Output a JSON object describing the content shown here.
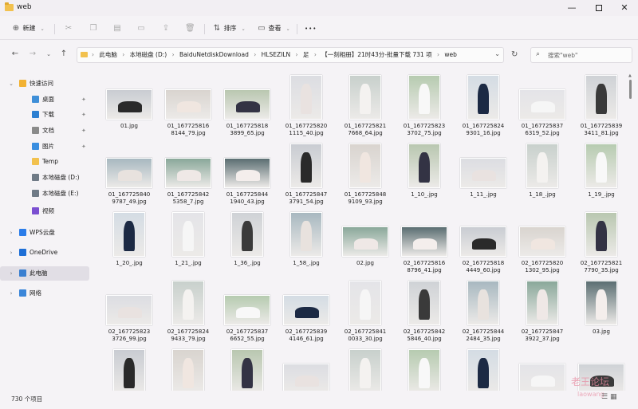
{
  "window": {
    "title": "web"
  },
  "toolbar": {
    "new_label": "新建",
    "sort_label": "排序",
    "view_label": "查看",
    "more_label": "•••"
  },
  "address": {
    "crumbs": [
      "此电脑",
      "本地磁盘 (D:)",
      "BaiduNetdiskDownload",
      "HLSEZILN",
      "足",
      "【一刻相册】21时43分-批量下载 731 项",
      "web"
    ],
    "search_placeholder": "搜索\"web\""
  },
  "sidebar": {
    "items": [
      {
        "label": "快速访问",
        "icon": "star-icon",
        "pinned": false
      },
      {
        "label": "桌面",
        "icon": "desktop-icon",
        "pinned": true
      },
      {
        "label": "下载",
        "icon": "download-icon",
        "pinned": true
      },
      {
        "label": "文档",
        "icon": "document-icon",
        "pinned": true
      },
      {
        "label": "图片",
        "icon": "pictures-icon",
        "pinned": true
      },
      {
        "label": "Temp",
        "icon": "folder-icon",
        "pinned": false
      },
      {
        "label": "本地磁盘 (D:)",
        "icon": "drive-icon",
        "pinned": false
      },
      {
        "label": "本地磁盘 (E:)",
        "icon": "drive-icon",
        "pinned": false
      },
      {
        "label": "视频",
        "icon": "video-icon",
        "pinned": false
      },
      {
        "label": "WPS云盘",
        "icon": "cloud-icon",
        "pinned": false
      },
      {
        "label": "OneDrive",
        "icon": "onedrive-icon",
        "pinned": false
      },
      {
        "label": "此电脑",
        "icon": "computer-icon",
        "pinned": false
      },
      {
        "label": "网络",
        "icon": "network-icon",
        "pinned": false
      }
    ]
  },
  "files": [
    [
      "01.jpg",
      "01_167725816\n8144_79.jpg",
      "01_167725818\n3899_65.jpg",
      "01_167725820\n1115_40.jpg",
      "01_167725821\n7668_64.jpg",
      "01_167725823\n3702_75.jpg",
      "01_167725824\n9301_16.jpg",
      "01_167725837\n6319_52.jpg",
      "01_167725839\n3411_81.jpg"
    ],
    [
      "01_167725840\n9787_49.jpg",
      "01_167725842\n5358_7.jpg",
      "01_167725844\n1940_43.jpg",
      "01_167725847\n3791_54.jpg",
      "01_167725848\n9109_93.jpg",
      "1_10_.jpg",
      "1_11_.jpg",
      "1_18_.jpg",
      "1_19_.jpg"
    ],
    [
      "1_20_.jpg",
      "1_21_.jpg",
      "1_36_.jpg",
      "1_58_.jpg",
      "02.jpg",
      "02_167725816\n8796_41.jpg",
      "02_167725818\n4449_60.jpg",
      "02_167725820\n1302_95.jpg",
      "02_167725821\n7790_35.jpg"
    ],
    [
      "02_167725823\n3726_99.jpg",
      "02_167725824\n9433_79.jpg",
      "02_167725837\n6652_55.jpg",
      "02_167725839\n4146_61.jpg",
      "02_167725841\n0033_30.jpg",
      "02_167725842\n5846_40.jpg",
      "02_167725844\n2484_35.jpg",
      "02_167725847\n3922_37.jpg",
      "03.jpg"
    ],
    [
      "",
      "",
      "",
      "",
      "",
      "",
      "",
      "",
      ""
    ]
  ],
  "status": {
    "count": "730 个项目"
  },
  "watermark": {
    "text": "老王论坛",
    "sub": "laowang"
  }
}
